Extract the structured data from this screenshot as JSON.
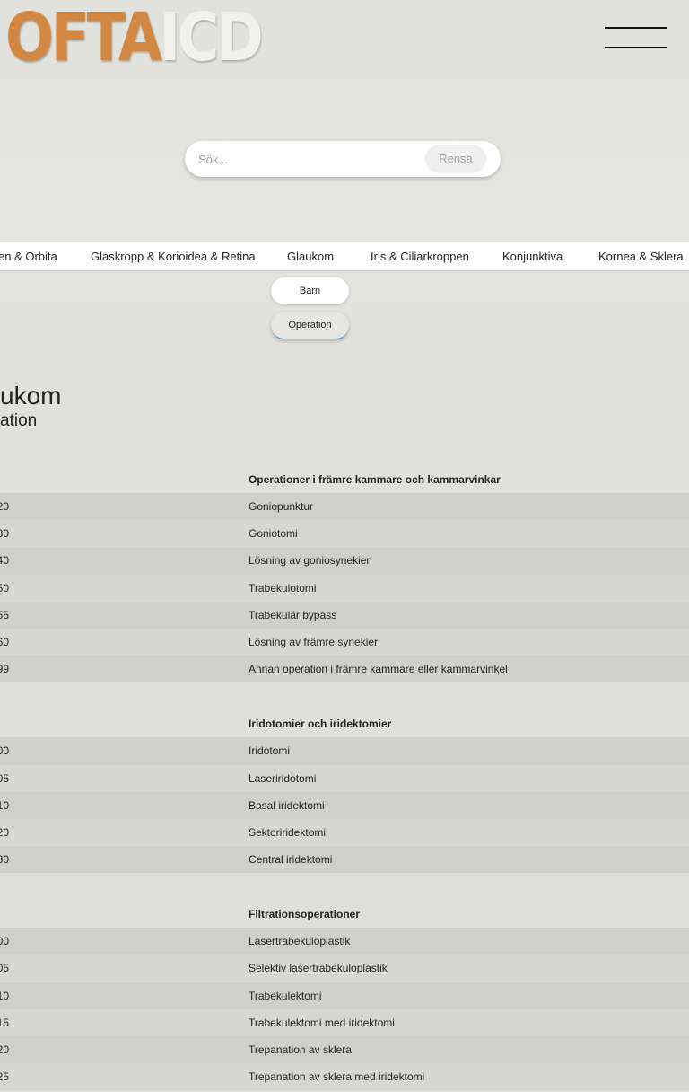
{
  "header": {
    "logo_part_1": "OFTA",
    "logo_part_2": "ICD"
  },
  "search": {
    "placeholder": "Sök...",
    "value": "",
    "clear_label": "Rensa"
  },
  "categories": [
    {
      "label": "en & Orbita"
    },
    {
      "label": "Glaskropp & Korioidea & Retina"
    },
    {
      "label": "Glaukom"
    },
    {
      "label": "Iris & Ciliarkroppen"
    },
    {
      "label": "Konjunktiva"
    },
    {
      "label": "Kornea & Sklera"
    }
  ],
  "subcategories": [
    {
      "label": "Barn"
    },
    {
      "label": "Operation",
      "selected": true
    }
  ],
  "page": {
    "title": "ukom",
    "subtitle": "ation"
  },
  "groups": [
    {
      "title": "Operationer i främre kammare och kammarvinkar",
      "rows": [
        {
          "code": "20",
          "desc": "Goniopunktur"
        },
        {
          "code": "30",
          "desc": "Goniotomi"
        },
        {
          "code": "40",
          "desc": "Lösning av goniosynekier"
        },
        {
          "code": "50",
          "desc": "Trabekulotomi"
        },
        {
          "code": "55",
          "desc": "Trabekulär bypass"
        },
        {
          "code": "60",
          "desc": "Lösning av främre synekier"
        },
        {
          "code": "99",
          "desc": "Annan operation i främre kammare eller kammarvinkel"
        }
      ]
    },
    {
      "title": "Iridotomier och iridektomier",
      "rows": [
        {
          "code": "00",
          "desc": "Iridotomi"
        },
        {
          "code": "05",
          "desc": "Laseriridotomi"
        },
        {
          "code": "10",
          "desc": "Basal iridektomi"
        },
        {
          "code": "20",
          "desc": "Sektoriridektomi"
        },
        {
          "code": "30",
          "desc": "Central iridektomi"
        }
      ]
    },
    {
      "title": "Filtrationsoperationer",
      "rows": [
        {
          "code": "00",
          "desc": "Lasertrabekuloplastik"
        },
        {
          "code": "05",
          "desc": "Selektiv lasertrabekuloplastik"
        },
        {
          "code": "10",
          "desc": "Trabekulektomi"
        },
        {
          "code": "15",
          "desc": "Trabekulektomi med iridektomi"
        },
        {
          "code": "20",
          "desc": "Trepanation av sklera"
        },
        {
          "code": "25",
          "desc": "Trepanation av sklera med iridektomi"
        }
      ]
    }
  ]
}
